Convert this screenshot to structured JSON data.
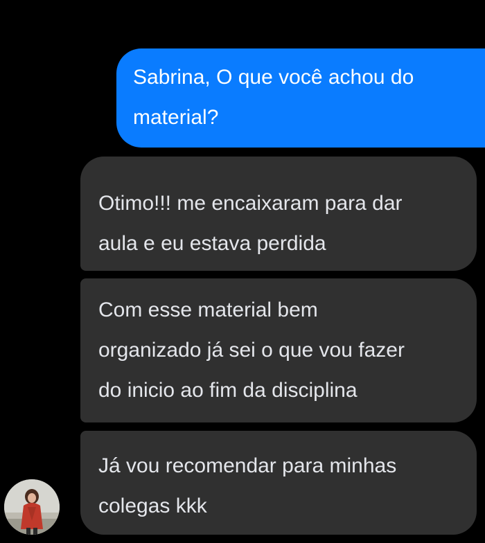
{
  "conversation": {
    "messages": [
      {
        "direction": "sent",
        "text": "Sabrina, O que você achou do\nmaterial?"
      },
      {
        "direction": "received",
        "text": "Otimo!!! me encaixaram para dar\naula e eu estava perdida"
      },
      {
        "direction": "received",
        "text": "Com esse material bem\norganizado já sei o que vou fazer\ndo inicio ao fim da disciplina"
      },
      {
        "direction": "received",
        "text": "Já vou recomendar para minhas\ncolegas kkk"
      }
    ]
  },
  "colors": {
    "background": "#000000",
    "sent_bubble": "#0a7cff",
    "received_bubble": "#303030",
    "text": "#e4e6eb"
  },
  "icons": {
    "avatar": "profile-photo"
  }
}
